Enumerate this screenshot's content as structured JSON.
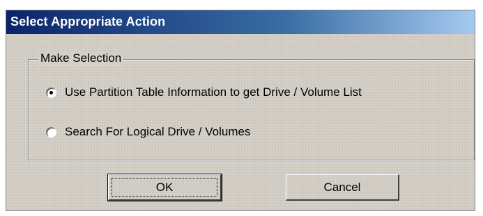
{
  "dialog": {
    "title": "Select Appropriate Action",
    "group_label": "Make Selection",
    "options": [
      {
        "label": "Use Partition Table Information to get  Drive / Volume List",
        "selected": true
      },
      {
        "label": "Search For Logical Drive / Volumes",
        "selected": false
      }
    ],
    "buttons": {
      "ok_label": "OK",
      "cancel_label": "Cancel"
    }
  },
  "colors": {
    "titlebar_start": "#0a246a",
    "titlebar_end": "#a6caf0",
    "dialog_face": "#d4d0c8"
  }
}
